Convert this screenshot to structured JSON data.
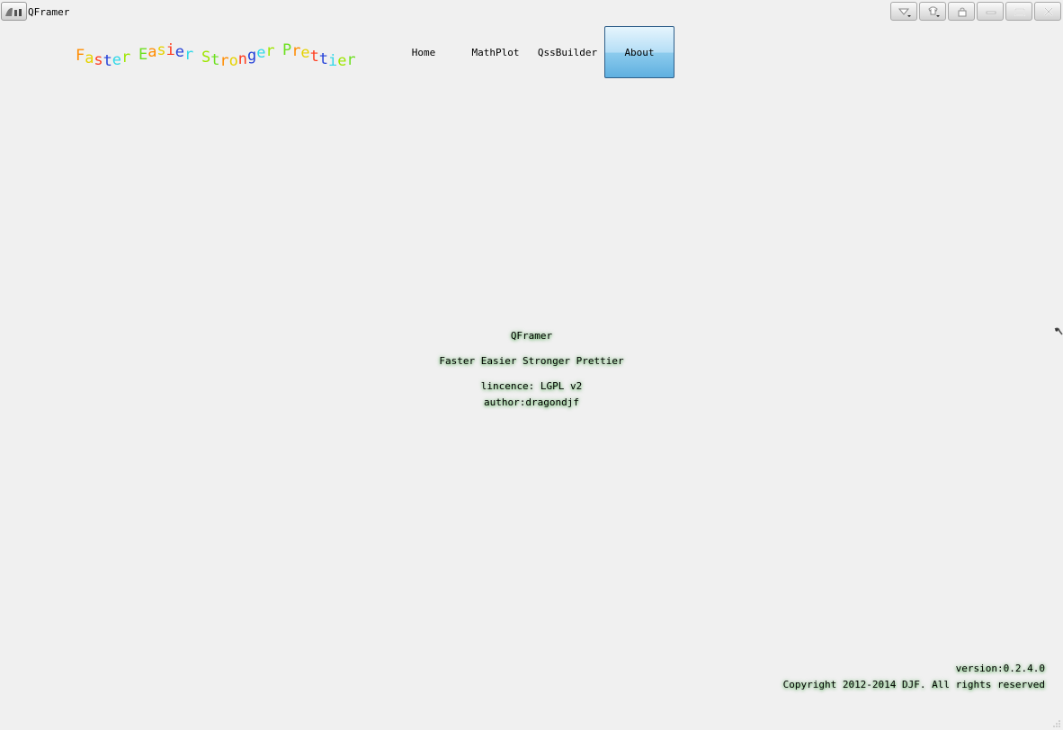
{
  "window": {
    "title": "QFramer",
    "controls": [
      {
        "name": "skin-menu-button",
        "icon": "dropdown-arrow-icon"
      },
      {
        "name": "style-menu-button",
        "icon": "shirt-icon"
      },
      {
        "name": "lock-button",
        "icon": "lock-icon"
      },
      {
        "name": "minimize-button",
        "icon": "minimize-icon"
      },
      {
        "name": "maximize-button",
        "icon": "maximize-icon"
      },
      {
        "name": "close-button",
        "icon": "close-icon"
      }
    ]
  },
  "header": {
    "tagline": [
      "Faster",
      "Easier",
      "Stronger",
      "Prettier"
    ],
    "tagline_colors": [
      "#ff8c00",
      "#e6d200",
      "#ff3c1e",
      "#2340d8",
      "#2ed8e8",
      "#9ee600",
      "#6de020"
    ]
  },
  "nav": {
    "items": [
      "Home",
      "MathPlot",
      "QssBuilder",
      "About"
    ],
    "active": "About"
  },
  "about": {
    "title": "QFramer",
    "tagline": "Faster Easier Stronger Prettier",
    "licence": "lincence: LGPL v2",
    "author": "author:dragondjf"
  },
  "footer": {
    "version": "version:0.2.4.0",
    "copyright": "Copyright 2012-2014 DJF. All rights reserved"
  },
  "colors": {
    "background": "#f0f0f0",
    "active_tab_top": "#e6f5fd",
    "active_tab_bottom": "#5fb0e0",
    "glow": "#46aa46"
  }
}
